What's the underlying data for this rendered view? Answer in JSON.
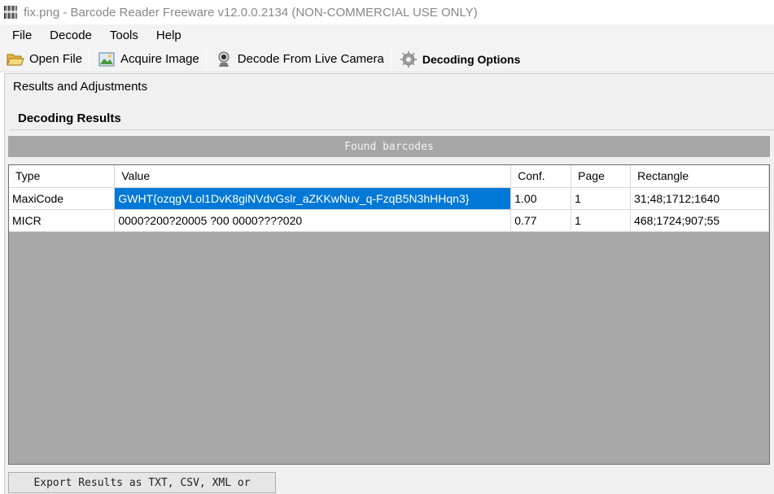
{
  "window": {
    "title": "fix.png - Barcode Reader Freeware v12.0.0.2134 (NON-COMMERCIAL USE ONLY)"
  },
  "menu": [
    "File",
    "Decode",
    "Tools",
    "Help"
  ],
  "toolbar": {
    "open_file": "Open File",
    "acquire_image": "Acquire Image",
    "decode_camera": "Decode From Live Camera",
    "decoding_options": "Decoding Options"
  },
  "panel": {
    "title": "Results and Adjustments",
    "section_title": "Decoding Results",
    "found_label": "Found barcodes"
  },
  "table": {
    "headers": [
      "Type",
      "Value",
      "Conf.",
      "Page",
      "Rectangle"
    ],
    "rows": [
      [
        "MaxiCode",
        "GWHT{ozqgVLol1DvK8giNVdvGslr_aZKKwNuv_q-FzqB5N3hHHqn3}",
        "1.00",
        "1",
        "31;48;1712;1640"
      ],
      [
        "MICR",
        "0000?200?20005 ?00 0000????020",
        "0.77",
        "1",
        "468;1724;907;55"
      ]
    ]
  },
  "export_label": "Export Results as TXT, CSV, XML or",
  "colors": {
    "selection": "#0078d7",
    "grid_background": "#a8a8a8",
    "found_bar": "#a6a6a6"
  }
}
